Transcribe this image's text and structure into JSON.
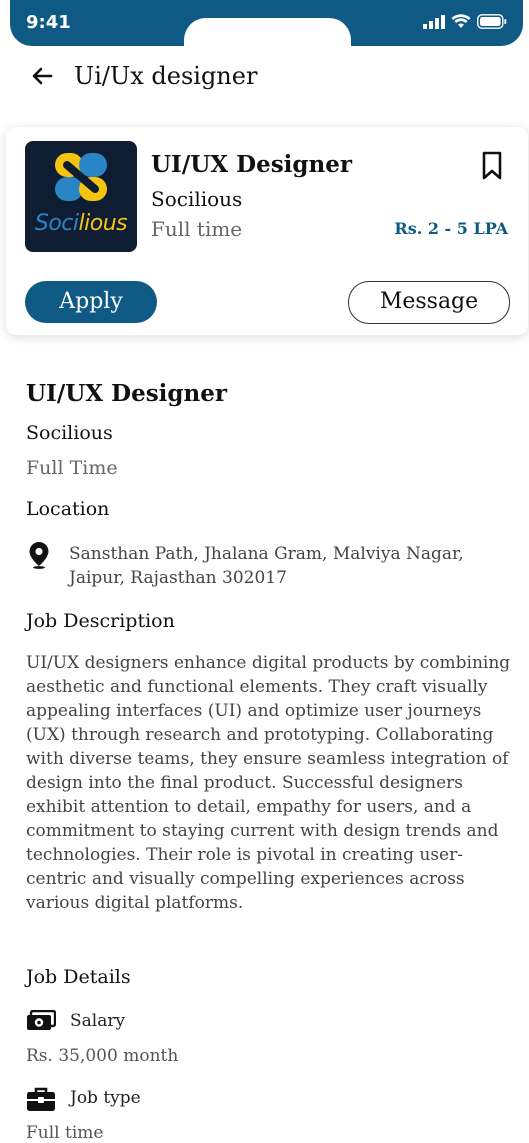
{
  "status_bar": {
    "time": "9:41"
  },
  "header": {
    "title": "Ui/Ux designer"
  },
  "card": {
    "logo_text_a": "Soci",
    "logo_text_b": "lious",
    "title": "UI/UX Designer",
    "company": "Socilious",
    "type": "Full time",
    "salary": "Rs. 2 - 5 LPA",
    "apply_label": "Apply",
    "message_label": "Message"
  },
  "details": {
    "title": "UI/UX Designer",
    "company": "Socilious",
    "type": "Full Time",
    "location_heading": "Location",
    "address": "Sansthan Path, Jhalana Gram, Malviya Nagar, Jaipur, Rajasthan 302017",
    "jd_heading": "Job Description",
    "jd_text": "UI/UX designers enhance digital products by combining aesthetic and functional elements. They craft visually appealing interfaces (UI) and optimize user journeys (UX) through research and prototyping. Collaborating with diverse teams, they ensure seamless integration of design into the final product. Successful designers exhibit attention to detail, empathy for users, and a commitment to staying current with design trends and technologies. Their role is pivotal in creating user-centric and visually compelling experiences across various digital platforms.",
    "job_details_heading": "Job Details",
    "salary_label": "Salary",
    "salary_value": "Rs. 35,000 month",
    "jobtype_label": "Job type",
    "jobtype_value": "Full time"
  },
  "colors": {
    "primary": "#0e5a85",
    "logo_bg": "#0f1d33",
    "logo_yellow": "#f4c40f",
    "logo_blue": "#2a85c6"
  },
  "icons": [
    "back-arrow-icon",
    "bookmark-icon",
    "location-pin-icon",
    "money-icon",
    "briefcase-icon",
    "signal-icon",
    "wifi-icon",
    "battery-icon"
  ]
}
